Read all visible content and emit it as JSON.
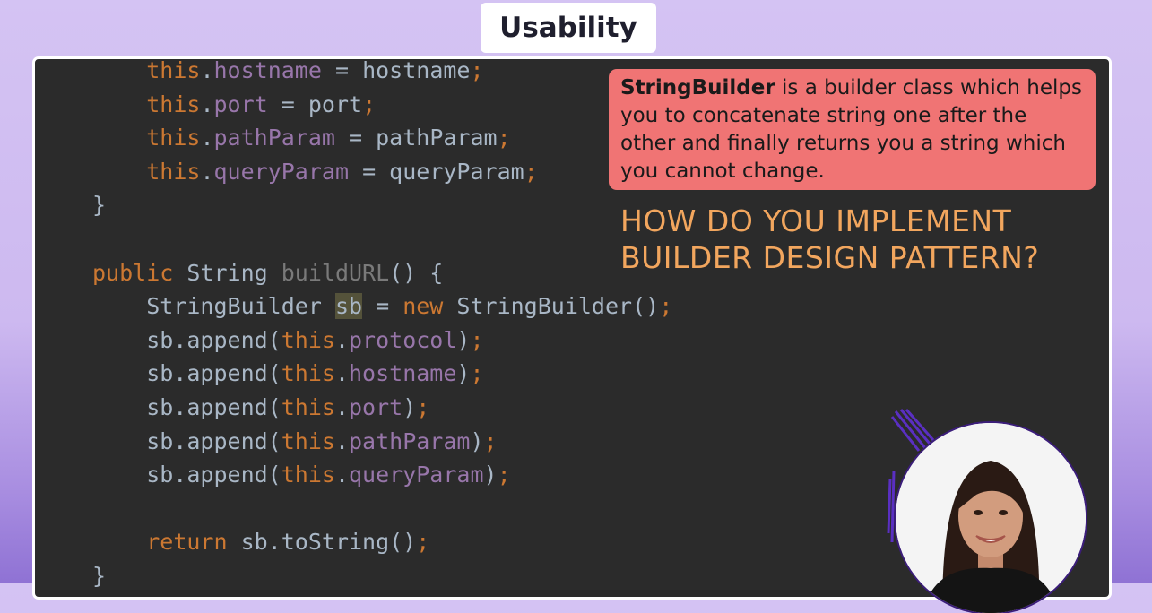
{
  "title": "Usability",
  "code_lines": [
    [
      {
        "t": "    "
      },
      {
        "t": "this",
        "c": "kw"
      },
      {
        "t": "."
      },
      {
        "t": "hostname",
        "c": "fld"
      },
      {
        "t": " = hostname"
      },
      {
        "t": ";",
        "c": "kw"
      }
    ],
    [
      {
        "t": "    "
      },
      {
        "t": "this",
        "c": "kw"
      },
      {
        "t": "."
      },
      {
        "t": "port",
        "c": "fld"
      },
      {
        "t": " = port"
      },
      {
        "t": ";",
        "c": "kw"
      }
    ],
    [
      {
        "t": "    "
      },
      {
        "t": "this",
        "c": "kw"
      },
      {
        "t": "."
      },
      {
        "t": "pathParam",
        "c": "fld"
      },
      {
        "t": " = pathParam"
      },
      {
        "t": ";",
        "c": "kw"
      }
    ],
    [
      {
        "t": "    "
      },
      {
        "t": "this",
        "c": "kw"
      },
      {
        "t": "."
      },
      {
        "t": "queryParam",
        "c": "fld"
      },
      {
        "t": " = queryParam"
      },
      {
        "t": ";",
        "c": "kw"
      }
    ],
    [
      {
        "t": "}"
      }
    ],
    [],
    [
      {
        "t": "public",
        "c": "kw"
      },
      {
        "t": " String "
      },
      {
        "t": "buildURL",
        "c": "mth"
      },
      {
        "t": "() {"
      }
    ],
    [
      {
        "t": "    StringBuilder "
      },
      {
        "t": "sb",
        "c": "hl"
      },
      {
        "t": " = "
      },
      {
        "t": "new",
        "c": "kw"
      },
      {
        "t": " StringBuilder()"
      },
      {
        "t": ";",
        "c": "kw"
      }
    ],
    [
      {
        "t": "    sb.append("
      },
      {
        "t": "this",
        "c": "kw"
      },
      {
        "t": "."
      },
      {
        "t": "protocol",
        "c": "fld"
      },
      {
        "t": ")"
      },
      {
        "t": ";",
        "c": "kw"
      }
    ],
    [
      {
        "t": "    sb.append("
      },
      {
        "t": "this",
        "c": "kw"
      },
      {
        "t": "."
      },
      {
        "t": "hostname",
        "c": "fld"
      },
      {
        "t": ")"
      },
      {
        "t": ";",
        "c": "kw"
      }
    ],
    [
      {
        "t": "    sb.append("
      },
      {
        "t": "this",
        "c": "kw"
      },
      {
        "t": "."
      },
      {
        "t": "port",
        "c": "fld"
      },
      {
        "t": ")"
      },
      {
        "t": ";",
        "c": "kw"
      }
    ],
    [
      {
        "t": "    sb.append("
      },
      {
        "t": "this",
        "c": "kw"
      },
      {
        "t": "."
      },
      {
        "t": "pathParam",
        "c": "fld"
      },
      {
        "t": ")"
      },
      {
        "t": ";",
        "c": "kw"
      }
    ],
    [
      {
        "t": "    sb.append("
      },
      {
        "t": "this",
        "c": "kw"
      },
      {
        "t": "."
      },
      {
        "t": "queryParam",
        "c": "fld"
      },
      {
        "t": ")"
      },
      {
        "t": ";",
        "c": "kw"
      }
    ],
    [],
    [
      {
        "t": "    "
      },
      {
        "t": "return",
        "c": "kw"
      },
      {
        "t": " sb.toString()"
      },
      {
        "t": ";",
        "c": "kw"
      }
    ],
    [
      {
        "t": "}"
      }
    ]
  ],
  "callout": {
    "bold": "StringBuilder",
    "rest": " is a builder class which helps you to concatenate string one after the other and finally returns you a string which you  cannot change."
  },
  "headline": "HOW DO YOU IMPLEMENT BUILDER DESIGN PATTERN?",
  "colors": {
    "keyword": "#cc7832",
    "field": "#9876aa",
    "callout_bg": "#f07474",
    "headline": "#f2a65e"
  },
  "icons": [
    "presenter-avatar"
  ]
}
